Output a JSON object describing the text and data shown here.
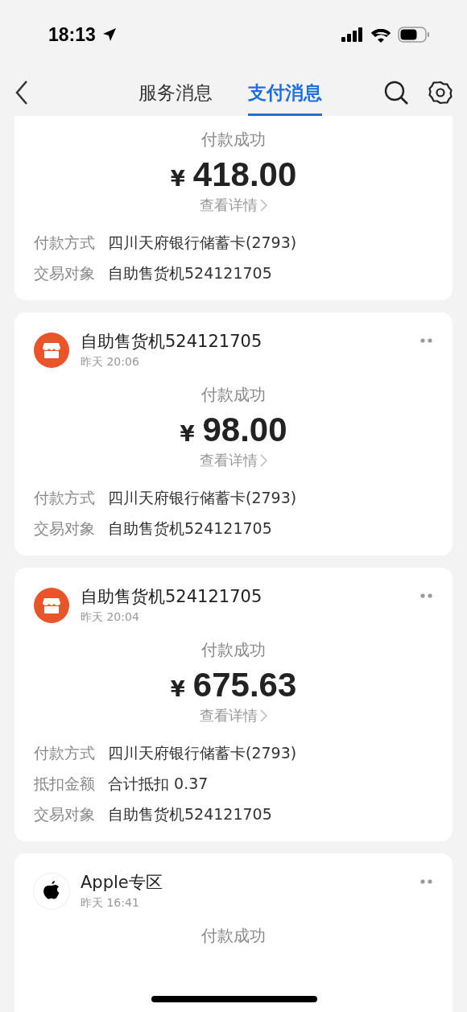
{
  "status_bar": {
    "time": "18:13"
  },
  "nav": {
    "tabs": [
      {
        "label": "服务消息",
        "selected": false
      },
      {
        "label": "支付消息",
        "selected": true
      }
    ]
  },
  "cards": [
    {
      "status": "付款成功",
      "currency": "¥",
      "amount": "418.00",
      "details_link": "查看详情",
      "rows": [
        {
          "label": "付款方式",
          "value": "四川天府银行储蓄卡(2793)"
        },
        {
          "label": "交易对象",
          "value": "自助售货机524121705"
        }
      ]
    },
    {
      "merchant": {
        "kind": "store",
        "name": "自助售货机524121705",
        "time": "昨天 20:06"
      },
      "status": "付款成功",
      "currency": "¥",
      "amount": "98.00",
      "details_link": "查看详情",
      "rows": [
        {
          "label": "付款方式",
          "value": "四川天府银行储蓄卡(2793)"
        },
        {
          "label": "交易对象",
          "value": "自助售货机524121705"
        }
      ]
    },
    {
      "merchant": {
        "kind": "store",
        "name": "自助售货机524121705",
        "time": "昨天 20:04"
      },
      "status": "付款成功",
      "currency": "¥",
      "amount": "675.63",
      "details_link": "查看详情",
      "rows": [
        {
          "label": "付款方式",
          "value": "四川天府银行储蓄卡(2793)"
        },
        {
          "label": "抵扣金额",
          "value": "合计抵扣 0.37"
        },
        {
          "label": "交易对象",
          "value": "自助售货机524121705"
        }
      ]
    },
    {
      "merchant": {
        "kind": "apple",
        "name": "Apple专区",
        "time": "昨天 16:41"
      },
      "status": "付款成功"
    }
  ]
}
